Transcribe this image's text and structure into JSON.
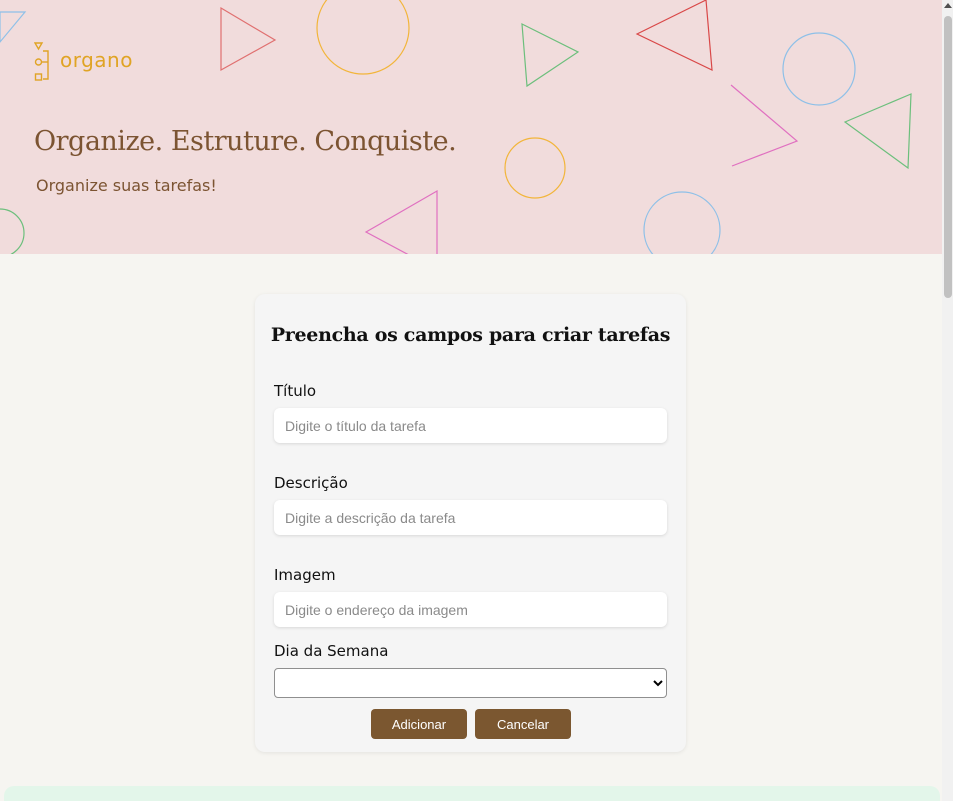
{
  "header": {
    "logo_text": "organo",
    "title": "Organize. Estruture. Conquiste.",
    "subtitle": "Organize suas tarefas!"
  },
  "form": {
    "title": "Preencha os campos para criar tarefas",
    "fields": [
      {
        "label": "Título",
        "placeholder": "Digite o título da tarefa",
        "value": ""
      },
      {
        "label": "Descrição",
        "placeholder": "Digite a descrição da tarefa",
        "value": ""
      },
      {
        "label": "Imagem",
        "placeholder": "Digite o endereço da imagem",
        "value": ""
      }
    ],
    "weekday": {
      "label": "Dia da Semana",
      "selected": ""
    },
    "buttons": {
      "add": "Adicionar",
      "cancel": "Cancelar"
    }
  },
  "colors": {
    "banner_bg": "#f1dcdc",
    "page_bg": "#f6f5f1",
    "brand_brown": "#7b5730",
    "logo_gold": "#e0a425",
    "footer_mint": "#e3f6ea"
  },
  "icons": {
    "logo": "organo-logo-icon",
    "select_arrow": "chevron-down-icon",
    "scroll_up": "arrow-up-icon"
  }
}
